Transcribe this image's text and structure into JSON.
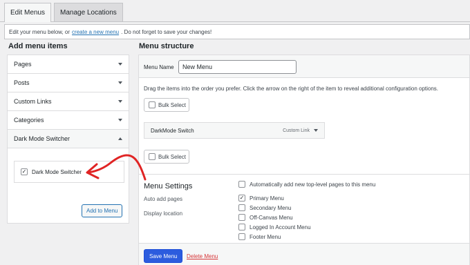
{
  "tabs": [
    {
      "label": "Edit Menus",
      "active": true
    },
    {
      "label": "Manage Locations",
      "active": false
    }
  ],
  "notice": {
    "prefix": "Edit your menu below, or",
    "link": "create a new menu",
    "suffix": ". Do not forget to save your changes!"
  },
  "left": {
    "title": "Add menu items",
    "sections": [
      {
        "label": "Pages",
        "expanded": false
      },
      {
        "label": "Posts",
        "expanded": false
      },
      {
        "label": "Custom Links",
        "expanded": false
      },
      {
        "label": "Categories",
        "expanded": false
      },
      {
        "label": "Dark Mode Switcher",
        "expanded": true
      }
    ],
    "dark_mode_checkbox": {
      "label": "Dark Mode Switcher",
      "checked": true
    },
    "add_button": "Add to Menu"
  },
  "right": {
    "title": "Menu structure",
    "menu_name_label": "Menu Name",
    "menu_name_value": "New Menu",
    "instructions": "Drag the items into the order you prefer. Click the arrow on the right of the item to reveal additional configuration options.",
    "bulk_select": "Bulk Select",
    "menu_item": {
      "title": "DarkMode Switch",
      "type": "Custom Link"
    },
    "settings": {
      "title": "Menu Settings",
      "auto_add_label": "Auto add pages",
      "auto_add_option": {
        "label": "Automatically add new top-level pages to this menu",
        "checked": false
      },
      "display_location_label": "Display location",
      "locations": [
        {
          "label": "Primary Menu",
          "checked": true
        },
        {
          "label": "Secondary Menu",
          "checked": false
        },
        {
          "label": "Off-Canvas Menu",
          "checked": false
        },
        {
          "label": "Logged In Account Menu",
          "checked": false
        },
        {
          "label": "Footer Menu",
          "checked": false
        }
      ]
    },
    "save_button": "Save Menu",
    "delete_link": "Delete Menu"
  },
  "colors": {
    "primary": "#2c5cde",
    "link": "#2271b1",
    "danger": "#d63638",
    "annotation_arrow": "#e02424"
  }
}
